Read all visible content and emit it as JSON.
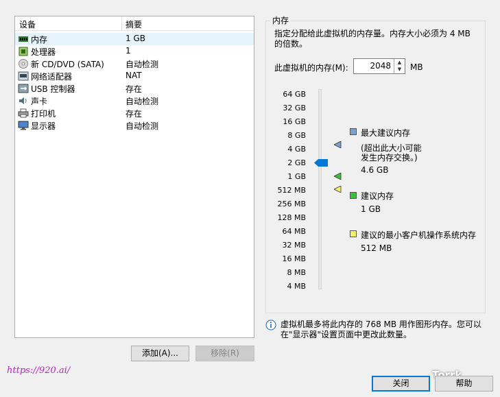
{
  "devices": {
    "col_device": "设备",
    "col_summary": "摘要",
    "rows": [
      {
        "name": "内存",
        "summary": "1 GB",
        "icon": "memory-icon"
      },
      {
        "name": "处理器",
        "summary": "1",
        "icon": "cpu-icon"
      },
      {
        "name": "新 CD/DVD (SATA)",
        "summary": "自动检测",
        "icon": "cd-icon"
      },
      {
        "name": "网络适配器",
        "summary": "NAT",
        "icon": "network-icon"
      },
      {
        "name": "USB 控制器",
        "summary": "存在",
        "icon": "usb-icon"
      },
      {
        "name": "声卡",
        "summary": "自动检测",
        "icon": "sound-icon"
      },
      {
        "name": "打印机",
        "summary": "存在",
        "icon": "printer-icon"
      },
      {
        "name": "显示器",
        "summary": "自动检测",
        "icon": "display-icon"
      }
    ]
  },
  "buttons": {
    "add": "添加(A)...",
    "remove": "移除(R)",
    "close": "关闭",
    "help": "帮助"
  },
  "memory": {
    "group_title": "内存",
    "description": "指定分配给此虚拟机的内存量。内存大小必须为 4 MB 的倍数。",
    "label": "此虚拟机的内存(M):",
    "value": "2048",
    "unit": "MB",
    "scale_ticks": [
      "64 GB",
      "32 GB",
      "16 GB",
      "8 GB",
      "4 GB",
      "2 GB",
      "1 GB",
      "512 MB",
      "256 MB",
      "128 MB",
      "64 MB",
      "32 MB",
      "16 MB",
      "8 MB",
      "4 MB"
    ],
    "legend": {
      "max_title": "最大建议内存",
      "max_note_1": "(超出此大小可能",
      "max_note_2": "发生内存交换。)",
      "max_value": "4.6 GB",
      "rec_title": "建议内存",
      "rec_value": "1 GB",
      "min_title": "建议的最小客户机操作系统内存",
      "min_value": "512 MB"
    },
    "colors": {
      "max": "#7a9fd1",
      "rec": "#3fbf3f",
      "min": "#f2ee6f",
      "thumb": "#0078d7"
    }
  },
  "info": {
    "text": "虚拟机最多将此内存的 768 MB 用作图形内存。您可以在\"显示器\"设置页面中更改此数量。"
  },
  "watermark": "https://920.ai/",
  "wechat_label": "Torrk"
}
